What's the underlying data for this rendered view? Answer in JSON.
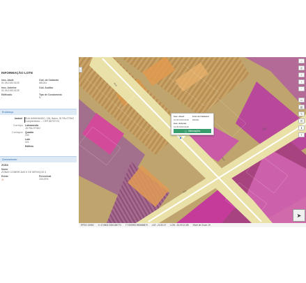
{
  "panel": {
    "title": "INFORMAÇÃO LOTE",
    "fields": [
      {
        "label": "Insc. Atual:",
        "value": "01.05.0153.0128"
      },
      {
        "label": "Cód. do Cadastro",
        "value": "681261"
      },
      {
        "label": "Insc. Anterior",
        "value": "01.05.0153.0128"
      },
      {
        "label": "Cód. Auditor",
        "value": "-"
      },
      {
        "label": "Edificado",
        "value": "-"
      },
      {
        "label": "Tipo de Condomínio",
        "value": "N"
      }
    ],
    "address_section": "Endereço",
    "address": {
      "tab_main": "Imóvel",
      "tab_corr": "Correspo",
      "tab_corr2": "Correspon",
      "street": "RUA AVANHANDO, 136, Bairro JD PALOTINO Complemento - - CEP 86707170",
      "loteamento_label": "Loteamento",
      "loteamento_value": "JD PALOTINO",
      "quadra_label": "Quadra",
      "quadra_value": "200",
      "lote_label": "Lote",
      "lote_value": "021",
      "edif_label": "Edifício",
      "edif_value": "-"
    },
    "zone_section": "Zoneamento",
    "zone": {
      "code": "ZCS3",
      "name_label": "Nome",
      "name_value": "ZONAS COMERCIAIS E DE SERVIÇOS 3",
      "exists_label": "Existe",
      "exists_value": "⚠",
      "percent_label": "Percentual",
      "percent_value": "100,00%"
    }
  },
  "popup": {
    "f1_label": "Insc. Atual:",
    "f1_value": "01.05.0153.0128",
    "f2_label": "Cód. do Cadastro",
    "f2_value": "681261",
    "f3_label": "Insc. Anterior",
    "f3_value": "01.05.0153.0128",
    "button": "Informações"
  },
  "status": {
    "epsg": "EPSG 31982",
    "x": "X: 474803.0340186773",
    "y": "Y:7405993.983586879",
    "lat": "LAT: -23.30.47",
    "lon": "LON: -51.09.21.88",
    "level": "Nível de Zoom 19"
  },
  "toolbar_icons": [
    "home-icon",
    "locate-icon",
    "layers-icon",
    "zoom-in-icon",
    "zoom-out-icon",
    "ruler-icon",
    "print-icon",
    "draw-icon",
    "settings-icon",
    "info-icon",
    "share-icon"
  ],
  "colors": {
    "magenta": "#c0379a",
    "orange": "#e28a36",
    "road": "#e9e1a8",
    "popup_btn": "#3a9d6d",
    "section_bg": "#dde9f5"
  }
}
